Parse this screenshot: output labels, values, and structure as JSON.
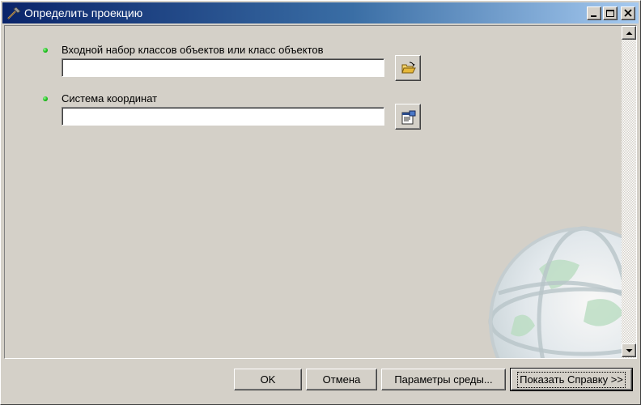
{
  "window": {
    "title": "Определить проекцию",
    "title_icon": "hammer-icon",
    "controls": [
      "minimize-icon",
      "maximize-icon",
      "close-icon"
    ]
  },
  "parameters": [
    {
      "label": "Входной набор классов объектов или класс объектов",
      "value": "",
      "required": true,
      "browse_icon": "open-folder-icon"
    },
    {
      "label": "Система координат",
      "value": "",
      "required": true,
      "browse_icon": "spatial-reference-properties-icon"
    }
  ],
  "buttons": {
    "ok": "OK",
    "cancel": "Отмена",
    "environments": "Параметры среды...",
    "show_help": "Показать Справку >>"
  },
  "colors": {
    "title_start": "#0a246a",
    "title_end": "#a6caf0",
    "dialog_bg": "#d4d0c8",
    "required_dot": "#18c018"
  }
}
